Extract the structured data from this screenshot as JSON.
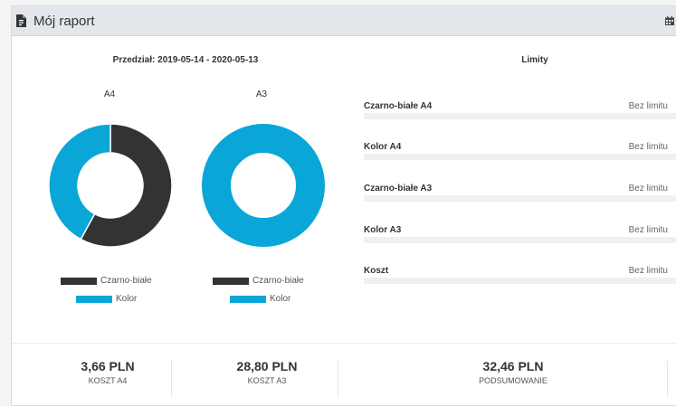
{
  "header": {
    "title": "Mój raport",
    "icon": "file-invoice-icon",
    "right_icon": "calendar-icon"
  },
  "range_label": "Przedział: 2019-05-14 - 2020-05-13",
  "colors": {
    "bw": "#333333",
    "color": "#0aa6d8"
  },
  "charts": [
    {
      "title": "A4",
      "slices": [
        {
          "name": "Czarno-białe",
          "value": 58
        },
        {
          "name": "Kolor",
          "value": 42
        }
      ]
    },
    {
      "title": "A3",
      "slices": [
        {
          "name": "Czarno-białe",
          "value": 0
        },
        {
          "name": "Kolor",
          "value": 100
        }
      ]
    }
  ],
  "legend": {
    "bw": "Czarno-białe",
    "color": "Kolor"
  },
  "limits": {
    "title": "Limity",
    "rows": [
      {
        "name": "Czarno-białe A4",
        "value": "Bez limitu"
      },
      {
        "name": "Kolor A4",
        "value": "Bez limitu"
      },
      {
        "name": "Czarno-białe A3",
        "value": "Bez limitu"
      },
      {
        "name": "Kolor A3",
        "value": "Bez limitu"
      },
      {
        "name": "Koszt",
        "value": "Bez limitu"
      }
    ]
  },
  "stats": [
    {
      "value": "3,66 PLN",
      "label": "KOSZT A4"
    },
    {
      "value": "28,80 PLN",
      "label": "KOSZT A3"
    },
    {
      "value": "32,46 PLN",
      "label": "PODSUMOWANIE"
    }
  ]
}
